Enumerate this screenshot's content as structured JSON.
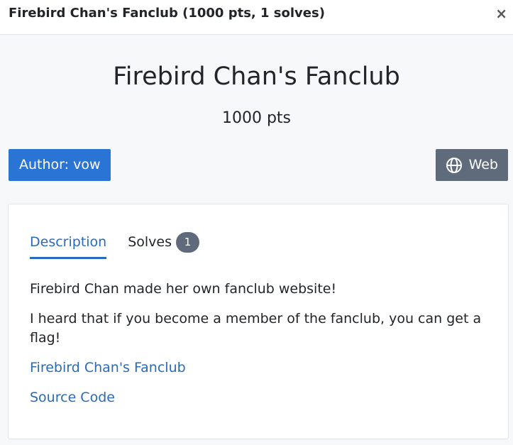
{
  "modal": {
    "title": "Firebird Chan's Fanclub (1000 pts, 1 solves)",
    "close_label": "×"
  },
  "challenge": {
    "name": "Firebird Chan's Fanclub",
    "points": "1000 pts",
    "author": "Author: vow",
    "category": "Web",
    "category_icon": "globe-icon"
  },
  "tabs": {
    "description_label": "Description",
    "solves_label": "Solves",
    "solves_count": "1"
  },
  "description": {
    "paragraphs": [
      "Firebird Chan made her own fanclub website!",
      "I heard that if you become a member of the fanclub, you can get a flag!"
    ],
    "links": [
      "Firebird Chan's Fanclub",
      "Source Code"
    ]
  },
  "colors": {
    "primary": "#2a74d5",
    "link": "#2a6ab8",
    "secondary": "#5f6b7a",
    "background": "#f7f8fa"
  }
}
